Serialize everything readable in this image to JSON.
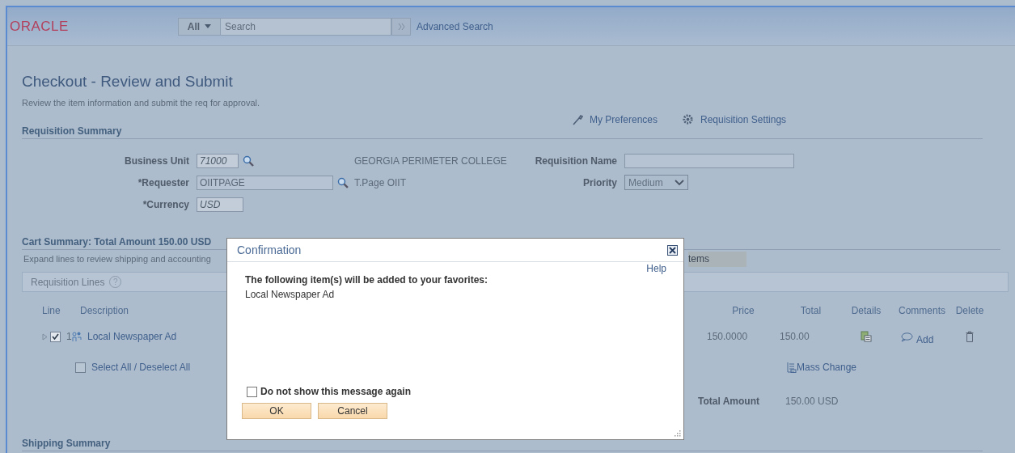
{
  "header": {
    "logo": "ORACLE",
    "search_scope": "All",
    "search_placeholder": "Search",
    "advanced_search": "Advanced Search"
  },
  "page": {
    "title": "Checkout - Review and Submit",
    "subtitle": "Review the item information and submit the req for approval.",
    "links": [
      {
        "kind": "preferences",
        "label": "My Preferences"
      },
      {
        "kind": "settings",
        "label": "Requisition Settings"
      }
    ]
  },
  "requisition_summary": {
    "heading": "Requisition Summary",
    "fields": [
      {
        "label": "Business Unit",
        "value": "71000",
        "disabled": true,
        "lookup": true,
        "description": "GEORGIA PERIMETER COLLEGE"
      },
      {
        "label": "*Requester",
        "value": "OIITPAGE",
        "disabled": false,
        "lookup": true,
        "description": "T.Page OIIT"
      },
      {
        "label": "*Currency",
        "value": "USD",
        "disabled": true,
        "lookup": false
      }
    ],
    "side_fields": [
      {
        "kind": "text",
        "label": "Requisition Name"
      },
      {
        "kind": "select",
        "label": "Priority",
        "value": "Medium"
      }
    ]
  },
  "cart": {
    "heading": "Cart Summary: Total Amount 150.00 USD",
    "instructions": "Expand lines to review shipping and accounting",
    "partial_button": "tems",
    "lines_title": "Requisition Lines",
    "lines_help": "?",
    "columns": [
      "Line",
      "Description",
      "Price",
      "Total",
      "Details",
      "Comments",
      "Delete"
    ],
    "rows": [
      {
        "expanded": false,
        "checked": true,
        "line": "1",
        "description": "Local Newspaper Ad",
        "price": "150.0000",
        "total": "150.00",
        "comment_link": "Add"
      }
    ],
    "select_all": {
      "label": "Select All / Deselect All",
      "checked": false
    },
    "mass_change": "Mass Change",
    "total_label": "Total Amount",
    "total_value": "150.00 USD"
  },
  "shipping": {
    "heading": "Shipping Summary"
  },
  "dialog": {
    "title": "Confirmation",
    "help": "Help",
    "message": "The following item(s) will be added to your favorites:",
    "items": [
      "Local Newspaper Ad"
    ],
    "checkbox": {
      "label": "Do not show this message again",
      "checked": false
    },
    "buttons": [
      "OK",
      "Cancel"
    ]
  }
}
